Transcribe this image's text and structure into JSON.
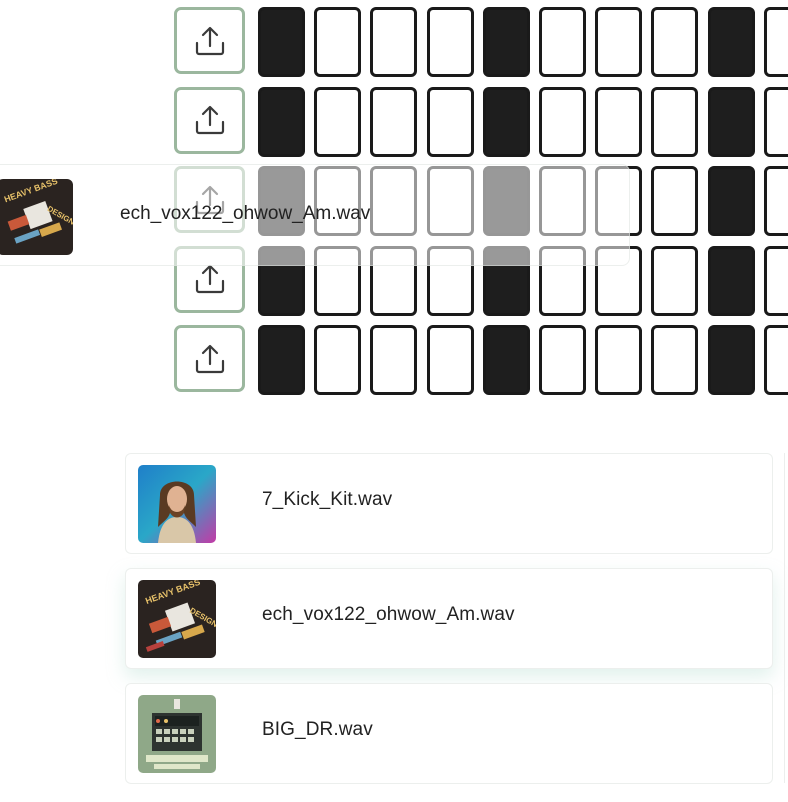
{
  "sequencer": {
    "upload_icon": "upload-icon",
    "rows": [
      {
        "pads": [
          true,
          false,
          false,
          false,
          true,
          false,
          false,
          false,
          true,
          false
        ]
      },
      {
        "pads": [
          true,
          false,
          false,
          false,
          true,
          false,
          false,
          false,
          true,
          false
        ]
      },
      {
        "pads": [
          true,
          false,
          false,
          false,
          true,
          false,
          false,
          false,
          true,
          false
        ]
      },
      {
        "pads": [
          true,
          false,
          false,
          false,
          true,
          false,
          false,
          false,
          true,
          false
        ]
      },
      {
        "pads": [
          true,
          false,
          false,
          false,
          true,
          false,
          false,
          false,
          true,
          false
        ]
      }
    ]
  },
  "dragging": {
    "filename": "ech_vox122_ohwow_Am.wav",
    "artwork": "heavy-bass-design-cover"
  },
  "samples": [
    {
      "filename": "7_Kick_Kit.wav",
      "artwork": "portrait-cover"
    },
    {
      "filename": "ech_vox122_ohwow_Am.wav",
      "artwork": "heavy-bass-design-cover"
    },
    {
      "filename": "BIG_DR.wav",
      "artwork": "drum-machine-cover"
    }
  ],
  "colors": {
    "upload_border": "#9bb79e",
    "pad_on": "#1e1e1e",
    "pad_border": "#1a1a1a"
  }
}
